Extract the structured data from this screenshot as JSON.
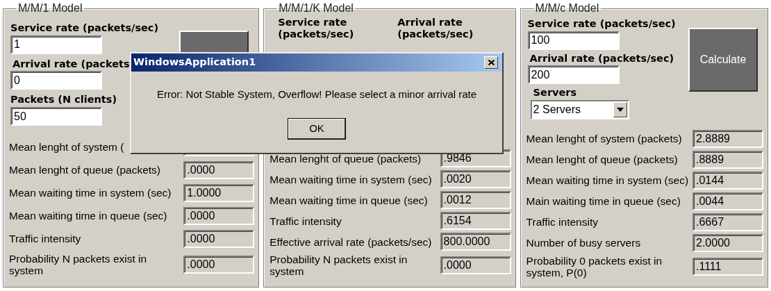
{
  "panels": [
    {
      "kind": "stacked",
      "title": "M/M/1 Model",
      "inputs": [
        {
          "label": "Service rate (packets/sec)",
          "value": "1"
        },
        {
          "label": "Arrival rate (packets",
          "value": "0"
        },
        {
          "label": "Packets (N clients)",
          "value": "50"
        }
      ],
      "button": {
        "covered": true
      },
      "results": [
        {
          "label": "Mean lenght of system ("
        },
        {
          "label": "Mean lenght of queue (packets)",
          "value": ".0000"
        },
        {
          "label": "Mean waiting time in system (sec)",
          "value": "1.0000"
        },
        {
          "label": "Mean waiting time in queue (sec)",
          "value": ".0000"
        },
        {
          "label": "Traffic intensity",
          "value": ".0000"
        },
        {
          "label": "Probability N packets exist in system",
          "value": ".0000"
        }
      ]
    },
    {
      "kind": "side_by_side",
      "title": "M/M/1/K Model",
      "inputs": [
        {
          "label": "Service rate (packets/sec)"
        },
        {
          "label": "Arrival rate (packets/sec)"
        }
      ],
      "results": [
        {
          "label": "Mean lenght of queue (packets)",
          "value": ".9846"
        },
        {
          "label": "Mean waiting time in system (sec)",
          "value": ".0020"
        },
        {
          "label": "Mean waiting time in queue (sec)",
          "value": ".0012"
        },
        {
          "label": "Traffic intensity",
          "value": ".6154"
        },
        {
          "label": "Effective arrival rate (packets/sec)",
          "value": "800.0000"
        },
        {
          "label": "Probability N packets exist in system",
          "value": ".0000"
        }
      ]
    },
    {
      "kind": "stacked",
      "title": "M/M/c Model",
      "inputs": [
        {
          "label": "Service rate (packets/sec)",
          "value": "100"
        },
        {
          "label": "Arrival rate (packets/sec)",
          "value": "200"
        }
      ],
      "dropdown": {
        "label": "Servers",
        "value": "2 Servers"
      },
      "button": {
        "label": "Calculate"
      },
      "results": [
        {
          "label": "Mean lenght of system (packets)",
          "value": "2.8889"
        },
        {
          "label": "Mean lenght of queue (packets)",
          "value": ".8889"
        },
        {
          "label": "Mean waiting time in system (sec)",
          "value": ".0144"
        },
        {
          "label": "Main waiting time in queue (sec)",
          "value": ".0044"
        },
        {
          "label": "Traffic intensity",
          "value": ".6667"
        },
        {
          "label": "Number of busy servers",
          "value": "2.0000"
        },
        {
          "label": "Probability 0 packets exist in system, P(0)",
          "value": ".1111"
        }
      ]
    }
  ],
  "dialog": {
    "title": "WindowsApplication1",
    "message": "Error: Not Stable System, Overflow! Please select a minor arrival rate",
    "button": "OK"
  }
}
